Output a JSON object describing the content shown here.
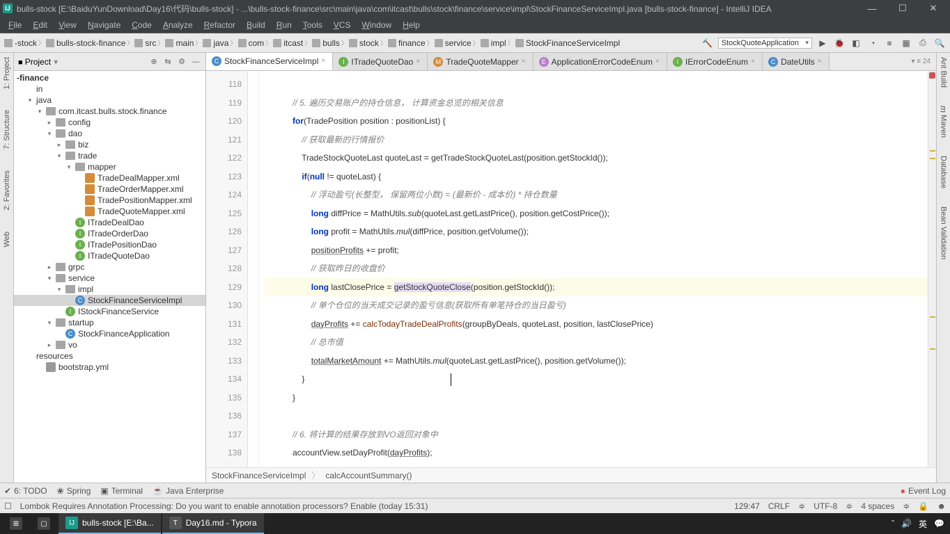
{
  "titlebar": {
    "title": "bulls-stock [E:\\BaiduYunDownload\\Day16\\代码\\bulls-stock] - ...\\bulls-stock-finance\\src\\main\\java\\com\\itcast\\bulls\\stock\\finance\\service\\impl\\StockFinanceServiceImpl.java [bulls-stock-finance] - IntelliJ IDEA"
  },
  "menus": [
    "File",
    "Edit",
    "View",
    "Navigate",
    "Code",
    "Analyze",
    "Refactor",
    "Build",
    "Run",
    "Tools",
    "VCS",
    "Window",
    "Help"
  ],
  "breadcrumbs": [
    "-stock",
    "bulls-stock-finance",
    "src",
    "main",
    "java",
    "com",
    "itcast",
    "bulls",
    "stock",
    "finance",
    "service",
    "impl",
    "StockFinanceServiceImpl"
  ],
  "runconfig": "StockQuoteApplication",
  "tabright": "▾ ≡ 24",
  "project": {
    "title": "Project",
    "root": "-finance",
    "items": [
      {
        "label": "in",
        "indent": 1
      },
      {
        "label": "java",
        "indent": 1,
        "caret": "▾"
      },
      {
        "label": "com.itcast.bulls.stock.finance",
        "indent": 2,
        "caret": "▾",
        "type": "folder"
      },
      {
        "label": "config",
        "indent": 3,
        "caret": "▸",
        "type": "folder"
      },
      {
        "label": "dao",
        "indent": 3,
        "caret": "▾",
        "type": "folder"
      },
      {
        "label": "biz",
        "indent": 4,
        "caret": "▸",
        "type": "folder"
      },
      {
        "label": "trade",
        "indent": 4,
        "caret": "▾",
        "type": "folder"
      },
      {
        "label": "mapper",
        "indent": 5,
        "caret": "▾",
        "type": "folder"
      },
      {
        "label": "TradeDealMapper.xml",
        "indent": 6,
        "type": "xml"
      },
      {
        "label": "TradeOrderMapper.xml",
        "indent": 6,
        "type": "xml"
      },
      {
        "label": "TradePositionMapper.xml",
        "indent": 6,
        "type": "xml"
      },
      {
        "label": "TradeQuoteMapper.xml",
        "indent": 6,
        "type": "xml"
      },
      {
        "label": "ITradeDealDao",
        "indent": 5,
        "type": "int"
      },
      {
        "label": "ITradeOrderDao",
        "indent": 5,
        "type": "int"
      },
      {
        "label": "ITradePositionDao",
        "indent": 5,
        "type": "int"
      },
      {
        "label": "ITradeQuoteDao",
        "indent": 5,
        "type": "int"
      },
      {
        "label": "grpc",
        "indent": 3,
        "caret": "▸",
        "type": "folder"
      },
      {
        "label": "service",
        "indent": 3,
        "caret": "▾",
        "type": "folder"
      },
      {
        "label": "impl",
        "indent": 4,
        "caret": "▾",
        "type": "folder"
      },
      {
        "label": "StockFinanceServiceImpl",
        "indent": 5,
        "type": "class",
        "selected": true
      },
      {
        "label": "IStockFinanceService",
        "indent": 4,
        "type": "int"
      },
      {
        "label": "startup",
        "indent": 3,
        "caret": "▾",
        "type": "folder"
      },
      {
        "label": "StockFinanceApplication",
        "indent": 4,
        "type": "class"
      },
      {
        "label": "vo",
        "indent": 3,
        "caret": "▸",
        "type": "folder"
      },
      {
        "label": "resources",
        "indent": 1
      },
      {
        "label": "bootstrap.yml",
        "indent": 2,
        "type": "yml"
      }
    ]
  },
  "tabs": [
    {
      "label": "StockFinanceServiceImpl",
      "icon": "c",
      "active": true
    },
    {
      "label": "ITradeQuoteDao",
      "icon": "i"
    },
    {
      "label": "TradeQuoteMapper",
      "icon": "m"
    },
    {
      "label": "ApplicationErrorCodeEnum",
      "icon": "e"
    },
    {
      "label": "IErrorCodeEnum",
      "icon": "i"
    },
    {
      "label": "DateUtils",
      "icon": "c"
    }
  ],
  "line_start": 118,
  "line_end": 138,
  "crumb2": {
    "a": "StockFinanceServiceImpl",
    "b": "calcAccountSummary()"
  },
  "toolrow": {
    "todo": "6: TODO",
    "spring": "Spring",
    "terminal": "Terminal",
    "java": "Java Enterprise",
    "eventlog": "Event Log"
  },
  "status": {
    "msg": "Lombok Requires Annotation Processing: Do you want to enable annotation processors? Enable (today 15:31)",
    "pos": "129:47",
    "crlf": "CRLF",
    "enc": "UTF-8",
    "indent": "4 spaces"
  },
  "taskbar": {
    "a": "bulls-stock [E:\\Ba...",
    "b": "Day16.md - Typora",
    "ime": "英"
  }
}
